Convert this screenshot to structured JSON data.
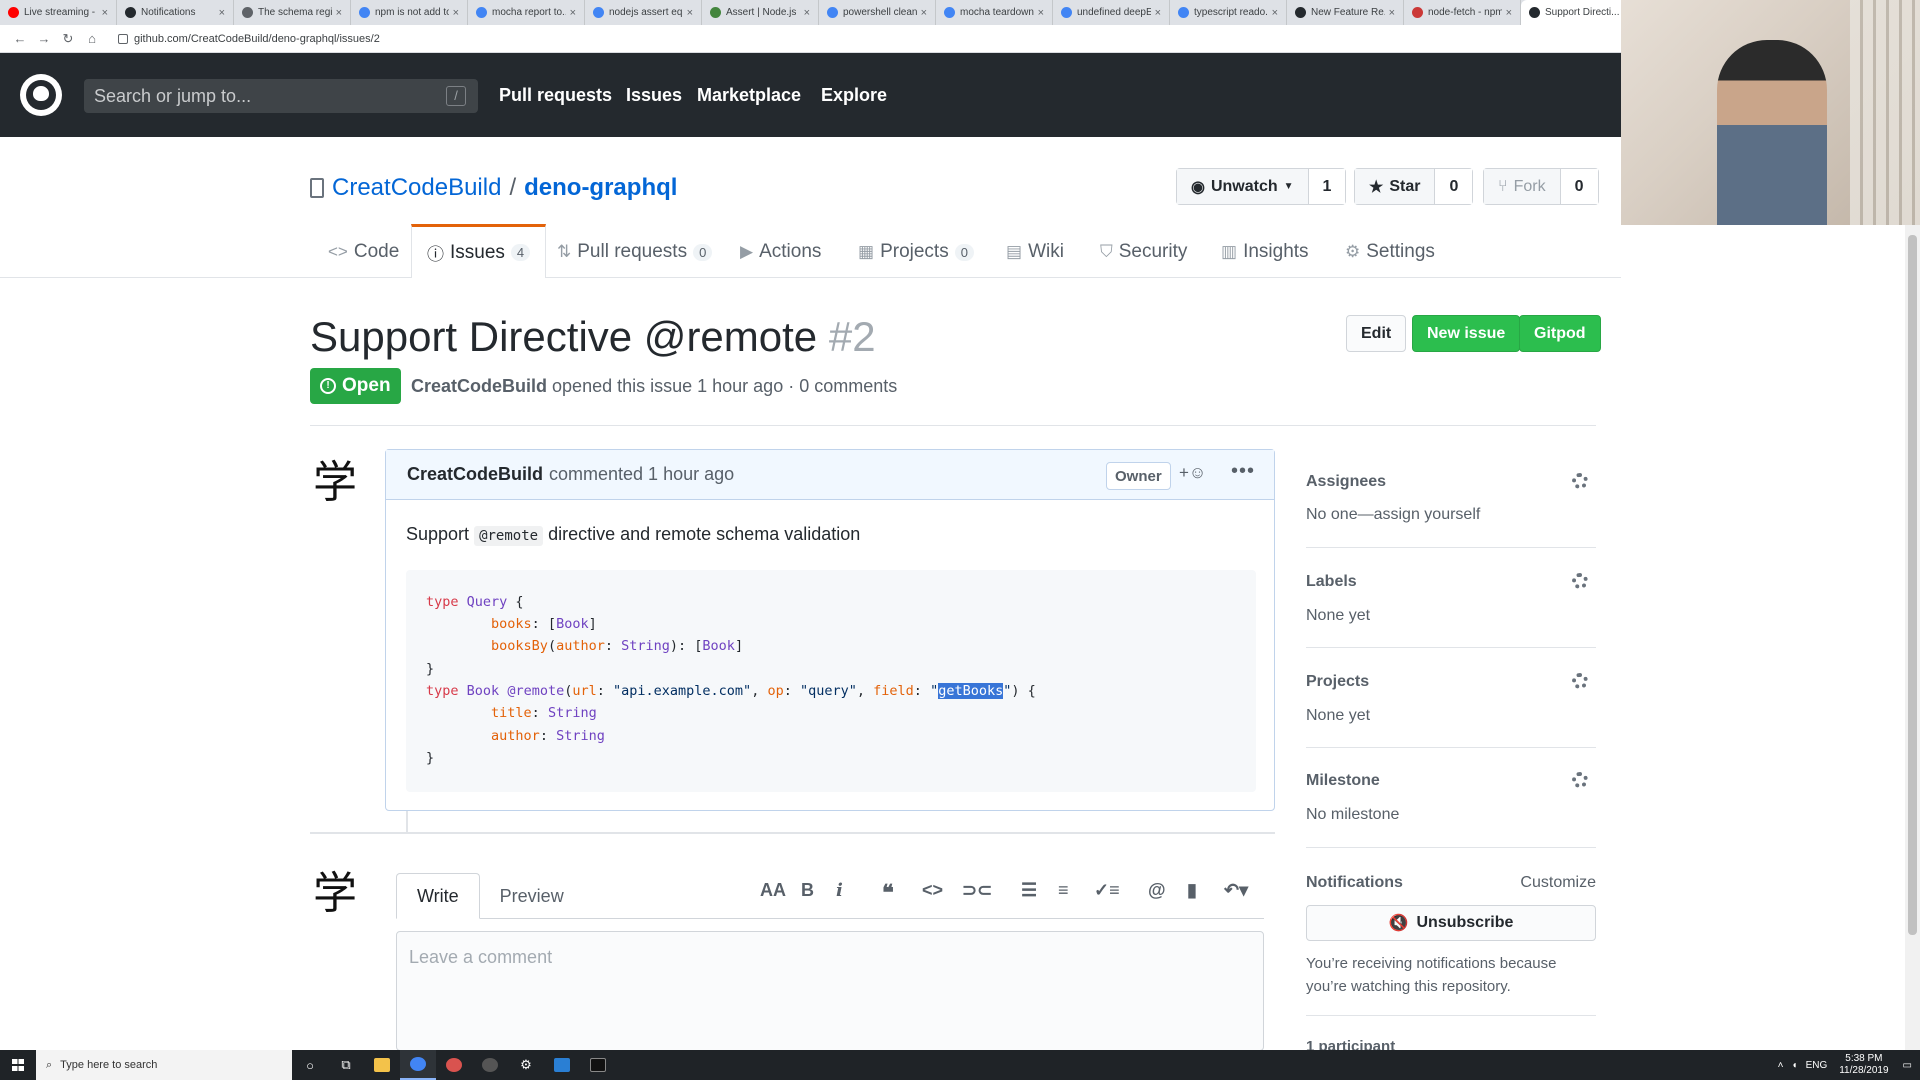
{
  "browser": {
    "tabs": [
      {
        "title": "Live streaming - ...",
        "color": "#ff0000"
      },
      {
        "title": "Notifications",
        "color": "#24292e"
      },
      {
        "title": "The schema regi...",
        "color": "#5f6368"
      },
      {
        "title": "npm is not add to...",
        "color": "#4285f4"
      },
      {
        "title": "mocha report to...",
        "color": "#4285f4"
      },
      {
        "title": "nodejs assert eq...",
        "color": "#4285f4"
      },
      {
        "title": "Assert | Node.js ...",
        "color": "#43853d"
      },
      {
        "title": "powershell clean...",
        "color": "#4285f4"
      },
      {
        "title": "mocha teardown...",
        "color": "#4285f4"
      },
      {
        "title": "undefined deepE...",
        "color": "#4285f4"
      },
      {
        "title": "typescript reado...",
        "color": "#4285f4"
      },
      {
        "title": "New Feature Re...",
        "color": "#24292e"
      },
      {
        "title": "node-fetch - npm",
        "color": "#cb3837"
      },
      {
        "title": "Support Directi...",
        "color": "#24292e"
      }
    ],
    "url": "github.com/CreatCodeBuild/deno-graphql/issues/2"
  },
  "header": {
    "search_placeholder": "Search or jump to...",
    "search_key": "/",
    "nav": [
      "Pull requests",
      "Issues",
      "Marketplace",
      "Explore"
    ]
  },
  "repo": {
    "owner": "CreatCodeBuild",
    "separator": "/",
    "name": "deno-graphql",
    "watch": {
      "label": "Unwatch",
      "count": "1"
    },
    "star": {
      "label": "Star",
      "count": "0"
    },
    "fork": {
      "label": "Fork",
      "count": "0"
    }
  },
  "repo_nav": {
    "code": "Code",
    "issues": {
      "label": "Issues",
      "count": "4"
    },
    "pulls": {
      "label": "Pull requests",
      "count": "0"
    },
    "actions": "Actions",
    "projects": {
      "label": "Projects",
      "count": "0"
    },
    "wiki": "Wiki",
    "security": "Security",
    "insights": "Insights",
    "settings": "Settings"
  },
  "issue": {
    "title": "Support Directive @remote",
    "number": "#2",
    "state": "Open",
    "author": "CreatCodeBuild",
    "meta_rest": "opened this issue 1 hour ago · 0 comments",
    "buttons": {
      "edit": "Edit",
      "new": "New issue",
      "gitpod": "Gitpod"
    }
  },
  "comment": {
    "author": "CreatCodeBuild",
    "time": "commented 1 hour ago",
    "badge": "Owner",
    "react": "+☺",
    "body_pre": "Support",
    "body_code": "@remote",
    "body_post": "directive and remote schema validation",
    "avatar_glyph": "学"
  },
  "write": {
    "tab_write": "Write",
    "tab_preview": "Preview",
    "placeholder": "Leave a comment",
    "avatar_glyph": "学"
  },
  "sidebar": {
    "assignees": {
      "title": "Assignees",
      "value": "No one—assign yourself"
    },
    "labels": {
      "title": "Labels",
      "value": "None yet"
    },
    "projects": {
      "title": "Projects",
      "value": "None yet"
    },
    "milestone": {
      "title": "Milestone",
      "value": "No milestone"
    },
    "notifications": {
      "title": "Notifications",
      "customize": "Customize",
      "unsubscribe": "Unsubscribe",
      "note": "You’re receiving notifications because you’re watching this repository."
    },
    "participants": "1 participant"
  },
  "taskbar": {
    "search": "Type here to search",
    "time": "5:38 PM",
    "date": "11/28/2019",
    "lang": "ENG"
  }
}
